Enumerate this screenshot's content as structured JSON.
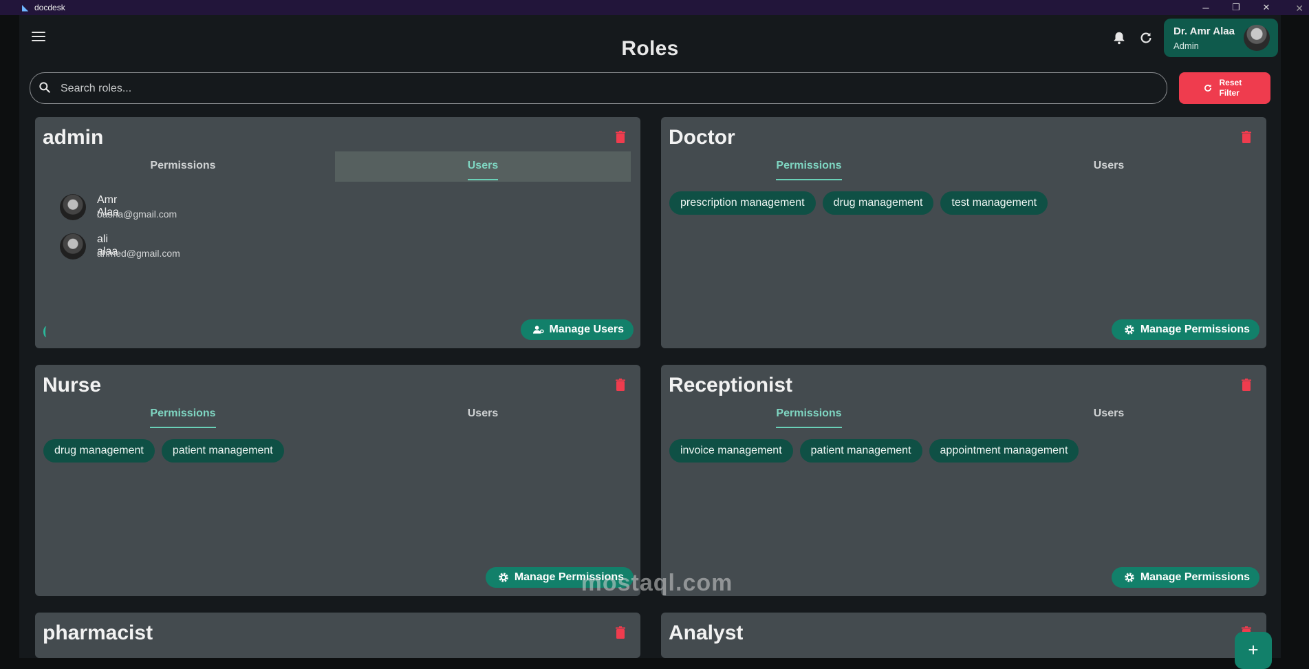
{
  "window": {
    "app_name": "docdesk"
  },
  "header": {
    "title": "Roles",
    "user": {
      "name": "Dr. Amr Alaa",
      "role": "Admin"
    }
  },
  "search": {
    "placeholder": "Search roles..."
  },
  "reset_button": {
    "label": "Reset Filter"
  },
  "tabs": {
    "permissions": "Permissions",
    "users": "Users"
  },
  "roles": [
    {
      "name": "admin",
      "active_tab": "users",
      "users": [
        {
          "name": "Amr Alaa",
          "email": "basha@gmail.com"
        },
        {
          "name": "ali alaa",
          "email": "ahmed@gmail.com"
        }
      ],
      "action_label": "Manage Users"
    },
    {
      "name": "Doctor",
      "active_tab": "permissions",
      "permissions": [
        "prescription management",
        "drug management",
        "test management"
      ],
      "action_label": "Manage Permissions"
    },
    {
      "name": "Nurse",
      "active_tab": "permissions",
      "permissions": [
        "drug management",
        "patient management"
      ],
      "action_label": "Manage Permissions"
    },
    {
      "name": "Receptionist",
      "active_tab": "permissions",
      "permissions": [
        "invoice management",
        "patient management",
        "appointment management"
      ],
      "action_label": "Manage Permissions"
    },
    {
      "name": "pharmacist"
    },
    {
      "name": "Analyst"
    }
  ],
  "fab": {
    "label": "+"
  },
  "watermark": {
    "text": "mostaql.com"
  },
  "colors": {
    "accent": "#12806a",
    "chip": "#0f5045",
    "danger": "#ef3c4e",
    "card": "#444b4f",
    "tab_active": "#7fd6c2"
  }
}
